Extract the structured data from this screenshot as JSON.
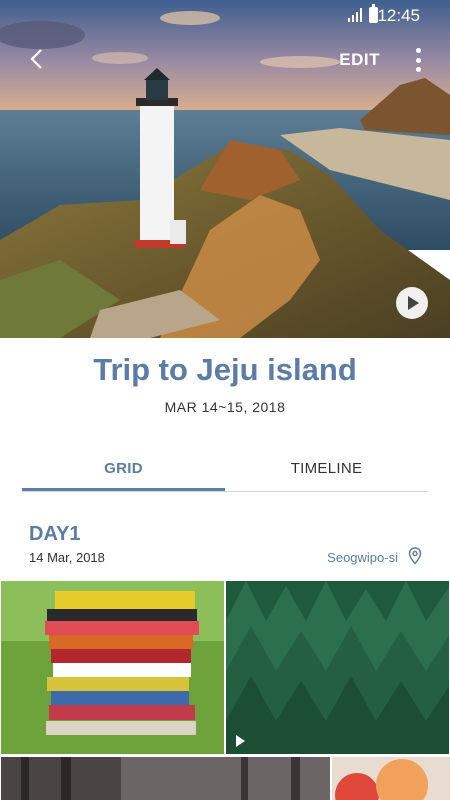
{
  "status_bar": {
    "time": "12:45"
  },
  "toolbar": {
    "edit_label": "EDIT"
  },
  "album": {
    "title": "Trip to Jeju island",
    "dates": "MAR 14~15, 2018"
  },
  "tabs": [
    {
      "label": "GRID",
      "active": true
    },
    {
      "label": "TIMELINE",
      "active": false
    }
  ],
  "day": {
    "title": "DAY1",
    "date": "14 Mar, 2018",
    "location": "Seogwipo-si"
  },
  "colors": {
    "accent": "#5b7ca6",
    "text": "#333333",
    "divider": "#d8d8d8"
  },
  "photos": [
    {
      "subject": "stack of books on grass",
      "type": "image"
    },
    {
      "subject": "pine forest",
      "type": "video"
    },
    {
      "subject": "foggy trees",
      "type": "image"
    },
    {
      "subject": "balloons",
      "type": "image"
    }
  ]
}
